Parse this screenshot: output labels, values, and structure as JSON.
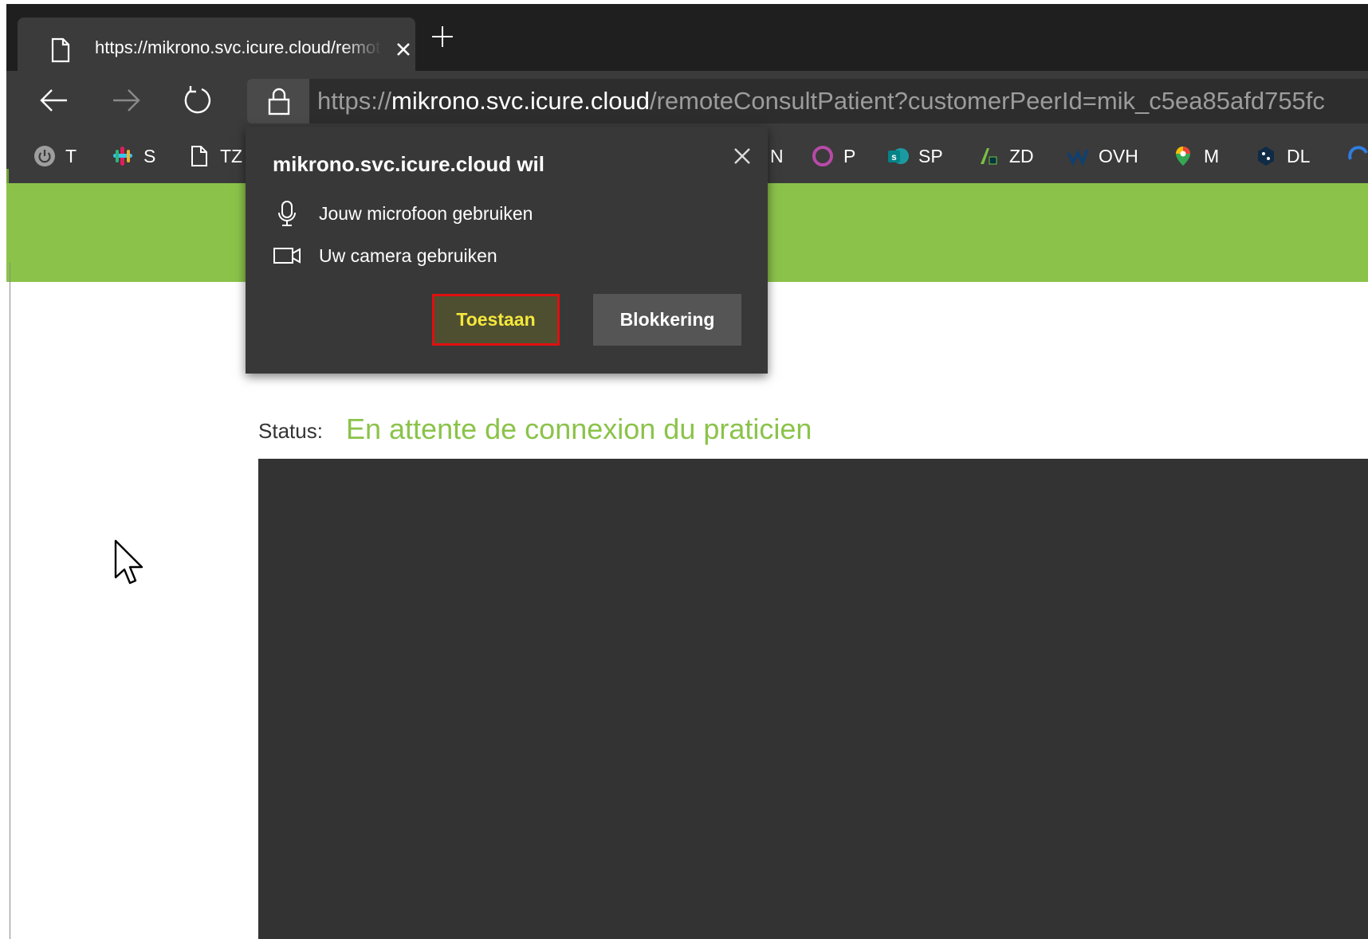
{
  "browser": {
    "tab": {
      "title": "https://mikrono.svc.icure.cloud/remoteConsultPatient"
    },
    "address_bar": {
      "url_scheme": "https://",
      "url_host": "mikrono.svc.icure.cloud",
      "url_path": "/remoteConsultPatient?customerPeerId=mik_c5ea85afd755fc"
    },
    "bookmarks": [
      {
        "label": "T",
        "icon": "power-icon"
      },
      {
        "label": "S",
        "icon": "slack-icon"
      },
      {
        "label": "TZ",
        "icon": "page-icon"
      },
      {
        "label": "N",
        "icon": "bookmark-icon"
      },
      {
        "label": "P",
        "icon": "circle-icon"
      },
      {
        "label": "SP",
        "icon": "sharepoint-icon"
      },
      {
        "label": "ZD",
        "icon": "zendesk-icon"
      },
      {
        "label": "OVH",
        "icon": "ovh-icon"
      },
      {
        "label": "M",
        "icon": "maps-pin-icon"
      },
      {
        "label": "DL",
        "icon": "deepl-icon"
      }
    ]
  },
  "permission_popup": {
    "title": "mikrono.svc.icure.cloud wil",
    "permissions": [
      {
        "label": "Jouw microfoon gebruiken",
        "icon": "microphone-icon"
      },
      {
        "label": "Uw camera gebruiken",
        "icon": "camera-icon"
      }
    ],
    "allow_label": "Toestaan",
    "block_label": "Blokkering"
  },
  "page": {
    "status_label": "Status:",
    "status_value": "En attente de connexion du praticien"
  },
  "colors": {
    "accent_green": "#8bc34a",
    "allow_text": "#f4e83c",
    "highlight_red": "#e01010"
  }
}
